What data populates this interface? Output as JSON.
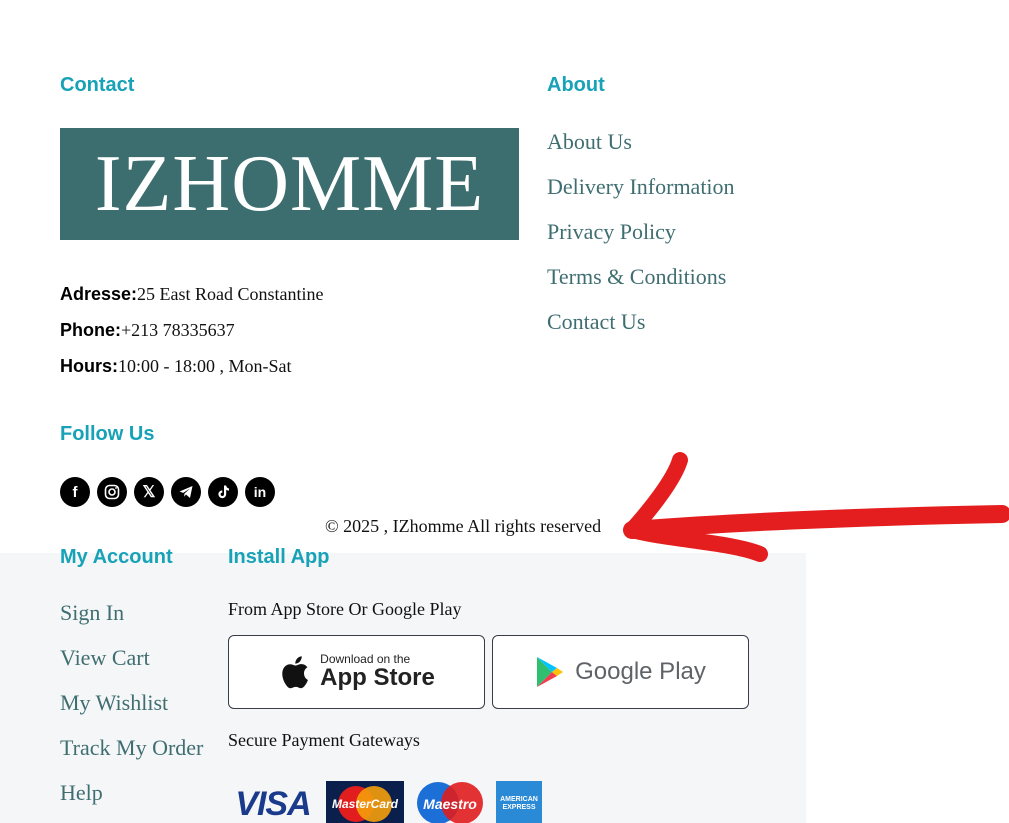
{
  "contact": {
    "heading": "Contact",
    "logo_text": "IZHOMME",
    "address_label": "Adresse:",
    "address_value": "25 East Road Constantine",
    "phone_label": "Phone:",
    "phone_value": "+213 78335637",
    "hours_label": "Hours:",
    "hours_value": "10:00 - 18:00 , Mon-Sat"
  },
  "about": {
    "heading": "About",
    "links": [
      "About Us",
      "Delivery Information",
      "Privacy Policy",
      "Terms & Conditions",
      "Contact Us"
    ]
  },
  "follow": {
    "heading": "Follow Us",
    "icons": [
      "facebook-icon",
      "instagram-icon",
      "x-icon",
      "telegram-icon",
      "tiktok-icon",
      "linkedin-icon"
    ],
    "facebook_glyph": "f",
    "x_glyph": "𝕏",
    "linkedin_glyph": "in"
  },
  "copyright": "© 2025 , IZhomme All rights reserved",
  "account": {
    "heading": "My Account",
    "links": [
      "Sign In",
      "View Cart",
      "My Wishlist",
      "Track My Order",
      "Help"
    ]
  },
  "install": {
    "heading": "Install App",
    "subtitle": "From App Store Or Google Play",
    "appstore_small": "Download on the",
    "appstore_big": "App Store",
    "googleplay_label": "Google Play",
    "payments_title": "Secure Payment Gateways",
    "visa_text": "VISA",
    "mastercard_text": "MasterCard",
    "maestro_text": "Maestro",
    "amex_text": "AMERICAN EXPRESS"
  },
  "colors": {
    "accent": "#17a2b8",
    "link": "#3f6e71",
    "logo_bg": "#3d6e6f",
    "arrow": "#e41e1e",
    "panel_bg": "#f5f6f8"
  }
}
